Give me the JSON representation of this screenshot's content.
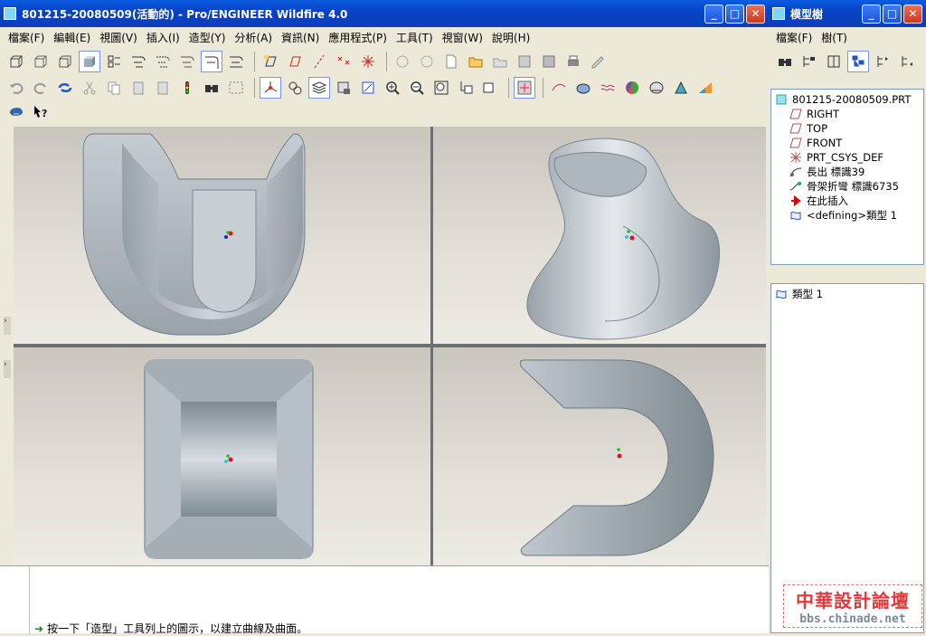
{
  "main_window": {
    "title": "801215-20080509(活動的) - Pro/ENGINEER Wildfire 4.0",
    "menu": [
      "檔案(F)",
      "編輯(E)",
      "視圖(V)",
      "插入(I)",
      "造型(Y)",
      "分析(A)",
      "資訊(N)",
      "應用程式(P)",
      "工具(T)",
      "視窗(W)",
      "說明(H)"
    ]
  },
  "model_tree_window": {
    "title": "模型樹",
    "menu": [
      "檔案(F)",
      "樹(T)"
    ],
    "root": "801215-20080509.PRT",
    "items": [
      {
        "label": "RIGHT",
        "icon": "datum-plane-icon"
      },
      {
        "label": "TOP",
        "icon": "datum-plane-icon"
      },
      {
        "label": "FRONT",
        "icon": "datum-plane-icon"
      },
      {
        "label": "PRT_CSYS_DEF",
        "icon": "csys-icon"
      },
      {
        "label": "長出 標識39",
        "icon": "protrusion-icon"
      },
      {
        "label": "骨架折彎 標識6735",
        "icon": "spinal-bend-icon"
      },
      {
        "label": "在此插入",
        "icon": "insert-here-arrow-icon"
      },
      {
        "label": "<defining>類型 1",
        "icon": "style-icon"
      }
    ],
    "lower_items": [
      {
        "label": "類型 1",
        "icon": "style-icon"
      }
    ]
  },
  "status": {
    "message": "按一下「造型」工具列上的圖示，以建立曲線及曲面。"
  },
  "watermark": {
    "line1": "中華設計論壇",
    "line2": "bbs.chinade.net"
  },
  "colors": {
    "title_blue": "#0a4fd6",
    "model_fill": "#b9c3cb",
    "pane_bg": "#dcdad2",
    "accent_red": "#e0141e"
  }
}
